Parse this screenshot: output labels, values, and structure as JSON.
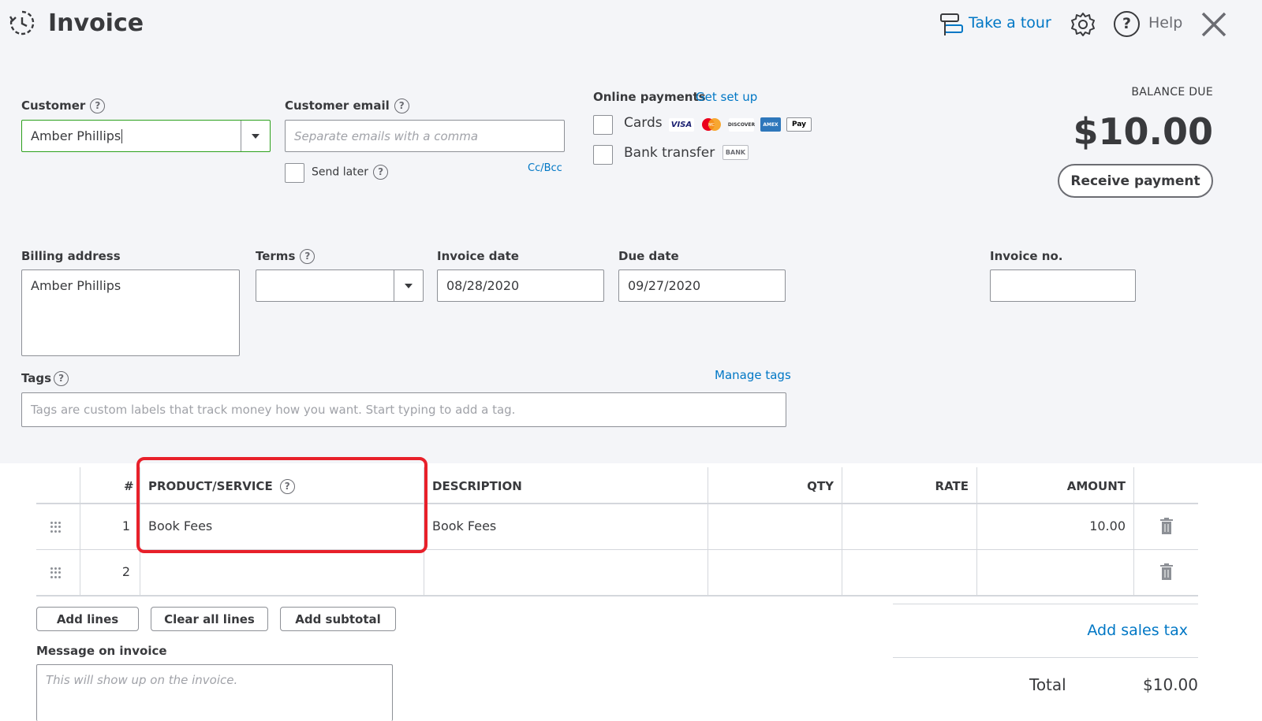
{
  "header": {
    "title": "Invoice",
    "tour_label": "Take a tour",
    "help_label": "Help"
  },
  "customer": {
    "label": "Customer",
    "value": "Amber Phillips"
  },
  "email": {
    "label": "Customer email",
    "placeholder": "Separate emails with a comma",
    "send_later": "Send later",
    "cc_bcc": "Cc/Bcc"
  },
  "online_payments": {
    "label": "Online payments",
    "setup_link": "Get set up",
    "cards_label": "Cards",
    "bank_label": "Bank transfer",
    "card_brands": [
      "VISA",
      "MC",
      "DISCOVER",
      "AMEX",
      "Pay"
    ],
    "bank_badge": "BANK"
  },
  "balance": {
    "label": "BALANCE DUE",
    "amount": "$10.00",
    "receive_button": "Receive payment"
  },
  "billing": {
    "label": "Billing address",
    "value": "Amber Phillips"
  },
  "terms": {
    "label": "Terms",
    "value": ""
  },
  "invoice_date": {
    "label": "Invoice date",
    "value": "08/28/2020"
  },
  "due_date": {
    "label": "Due date",
    "value": "09/27/2020"
  },
  "invoice_no": {
    "label": "Invoice no.",
    "value": ""
  },
  "tags": {
    "label": "Tags",
    "manage_link": "Manage tags",
    "placeholder": "Tags are custom labels that track money how you want. Start typing to add a tag."
  },
  "table": {
    "headers": {
      "num": "#",
      "product": "PRODUCT/SERVICE",
      "description": "DESCRIPTION",
      "qty": "QTY",
      "rate": "RATE",
      "amount": "AMOUNT"
    },
    "rows": [
      {
        "num": "1",
        "product": "Book Fees",
        "description": "Book Fees",
        "qty": "",
        "rate": "",
        "amount": "10.00"
      },
      {
        "num": "2",
        "product": "",
        "description": "",
        "qty": "",
        "rate": "",
        "amount": ""
      }
    ]
  },
  "actions": {
    "add_lines": "Add lines",
    "clear_lines": "Clear all lines",
    "add_subtotal": "Add subtotal"
  },
  "message": {
    "label": "Message on invoice",
    "placeholder": "This will show up on the invoice."
  },
  "totals": {
    "add_sales_tax": "Add sales tax",
    "total_label": "Total",
    "total_value": "$10.00"
  },
  "colors": {
    "link": "#0077c5",
    "highlight": "#e8202a",
    "focus_border": "#2ca01c"
  }
}
